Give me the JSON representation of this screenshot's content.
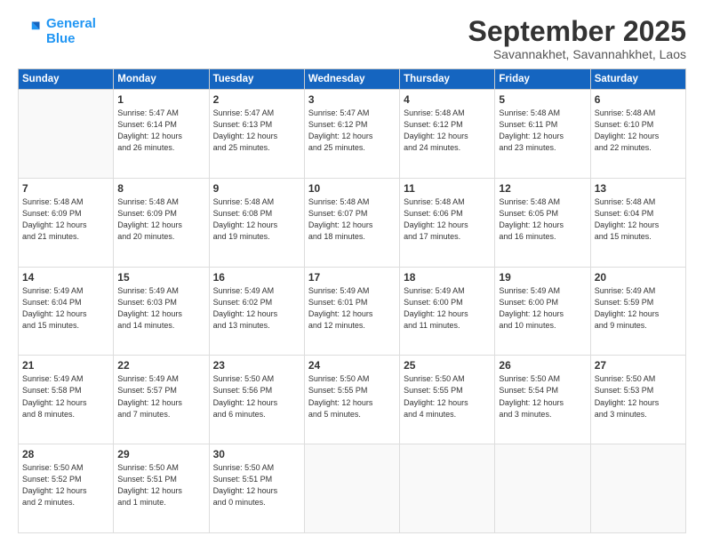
{
  "logo": {
    "line1": "General",
    "line2": "Blue"
  },
  "title": "September 2025",
  "subtitle": "Savannakhet, Savannahkhet, Laos",
  "header_days": [
    "Sunday",
    "Monday",
    "Tuesday",
    "Wednesday",
    "Thursday",
    "Friday",
    "Saturday"
  ],
  "weeks": [
    [
      {
        "day": "",
        "info": ""
      },
      {
        "day": "1",
        "info": "Sunrise: 5:47 AM\nSunset: 6:14 PM\nDaylight: 12 hours\nand 26 minutes."
      },
      {
        "day": "2",
        "info": "Sunrise: 5:47 AM\nSunset: 6:13 PM\nDaylight: 12 hours\nand 25 minutes."
      },
      {
        "day": "3",
        "info": "Sunrise: 5:47 AM\nSunset: 6:12 PM\nDaylight: 12 hours\nand 25 minutes."
      },
      {
        "day": "4",
        "info": "Sunrise: 5:48 AM\nSunset: 6:12 PM\nDaylight: 12 hours\nand 24 minutes."
      },
      {
        "day": "5",
        "info": "Sunrise: 5:48 AM\nSunset: 6:11 PM\nDaylight: 12 hours\nand 23 minutes."
      },
      {
        "day": "6",
        "info": "Sunrise: 5:48 AM\nSunset: 6:10 PM\nDaylight: 12 hours\nand 22 minutes."
      }
    ],
    [
      {
        "day": "7",
        "info": "Sunrise: 5:48 AM\nSunset: 6:09 PM\nDaylight: 12 hours\nand 21 minutes."
      },
      {
        "day": "8",
        "info": "Sunrise: 5:48 AM\nSunset: 6:09 PM\nDaylight: 12 hours\nand 20 minutes."
      },
      {
        "day": "9",
        "info": "Sunrise: 5:48 AM\nSunset: 6:08 PM\nDaylight: 12 hours\nand 19 minutes."
      },
      {
        "day": "10",
        "info": "Sunrise: 5:48 AM\nSunset: 6:07 PM\nDaylight: 12 hours\nand 18 minutes."
      },
      {
        "day": "11",
        "info": "Sunrise: 5:48 AM\nSunset: 6:06 PM\nDaylight: 12 hours\nand 17 minutes."
      },
      {
        "day": "12",
        "info": "Sunrise: 5:48 AM\nSunset: 6:05 PM\nDaylight: 12 hours\nand 16 minutes."
      },
      {
        "day": "13",
        "info": "Sunrise: 5:48 AM\nSunset: 6:04 PM\nDaylight: 12 hours\nand 15 minutes."
      }
    ],
    [
      {
        "day": "14",
        "info": "Sunrise: 5:49 AM\nSunset: 6:04 PM\nDaylight: 12 hours\nand 15 minutes."
      },
      {
        "day": "15",
        "info": "Sunrise: 5:49 AM\nSunset: 6:03 PM\nDaylight: 12 hours\nand 14 minutes."
      },
      {
        "day": "16",
        "info": "Sunrise: 5:49 AM\nSunset: 6:02 PM\nDaylight: 12 hours\nand 13 minutes."
      },
      {
        "day": "17",
        "info": "Sunrise: 5:49 AM\nSunset: 6:01 PM\nDaylight: 12 hours\nand 12 minutes."
      },
      {
        "day": "18",
        "info": "Sunrise: 5:49 AM\nSunset: 6:00 PM\nDaylight: 12 hours\nand 11 minutes."
      },
      {
        "day": "19",
        "info": "Sunrise: 5:49 AM\nSunset: 6:00 PM\nDaylight: 12 hours\nand 10 minutes."
      },
      {
        "day": "20",
        "info": "Sunrise: 5:49 AM\nSunset: 5:59 PM\nDaylight: 12 hours\nand 9 minutes."
      }
    ],
    [
      {
        "day": "21",
        "info": "Sunrise: 5:49 AM\nSunset: 5:58 PM\nDaylight: 12 hours\nand 8 minutes."
      },
      {
        "day": "22",
        "info": "Sunrise: 5:49 AM\nSunset: 5:57 PM\nDaylight: 12 hours\nand 7 minutes."
      },
      {
        "day": "23",
        "info": "Sunrise: 5:50 AM\nSunset: 5:56 PM\nDaylight: 12 hours\nand 6 minutes."
      },
      {
        "day": "24",
        "info": "Sunrise: 5:50 AM\nSunset: 5:55 PM\nDaylight: 12 hours\nand 5 minutes."
      },
      {
        "day": "25",
        "info": "Sunrise: 5:50 AM\nSunset: 5:55 PM\nDaylight: 12 hours\nand 4 minutes."
      },
      {
        "day": "26",
        "info": "Sunrise: 5:50 AM\nSunset: 5:54 PM\nDaylight: 12 hours\nand 3 minutes."
      },
      {
        "day": "27",
        "info": "Sunrise: 5:50 AM\nSunset: 5:53 PM\nDaylight: 12 hours\nand 3 minutes."
      }
    ],
    [
      {
        "day": "28",
        "info": "Sunrise: 5:50 AM\nSunset: 5:52 PM\nDaylight: 12 hours\nand 2 minutes."
      },
      {
        "day": "29",
        "info": "Sunrise: 5:50 AM\nSunset: 5:51 PM\nDaylight: 12 hours\nand 1 minute."
      },
      {
        "day": "30",
        "info": "Sunrise: 5:50 AM\nSunset: 5:51 PM\nDaylight: 12 hours\nand 0 minutes."
      },
      {
        "day": "",
        "info": ""
      },
      {
        "day": "",
        "info": ""
      },
      {
        "day": "",
        "info": ""
      },
      {
        "day": "",
        "info": ""
      }
    ]
  ]
}
